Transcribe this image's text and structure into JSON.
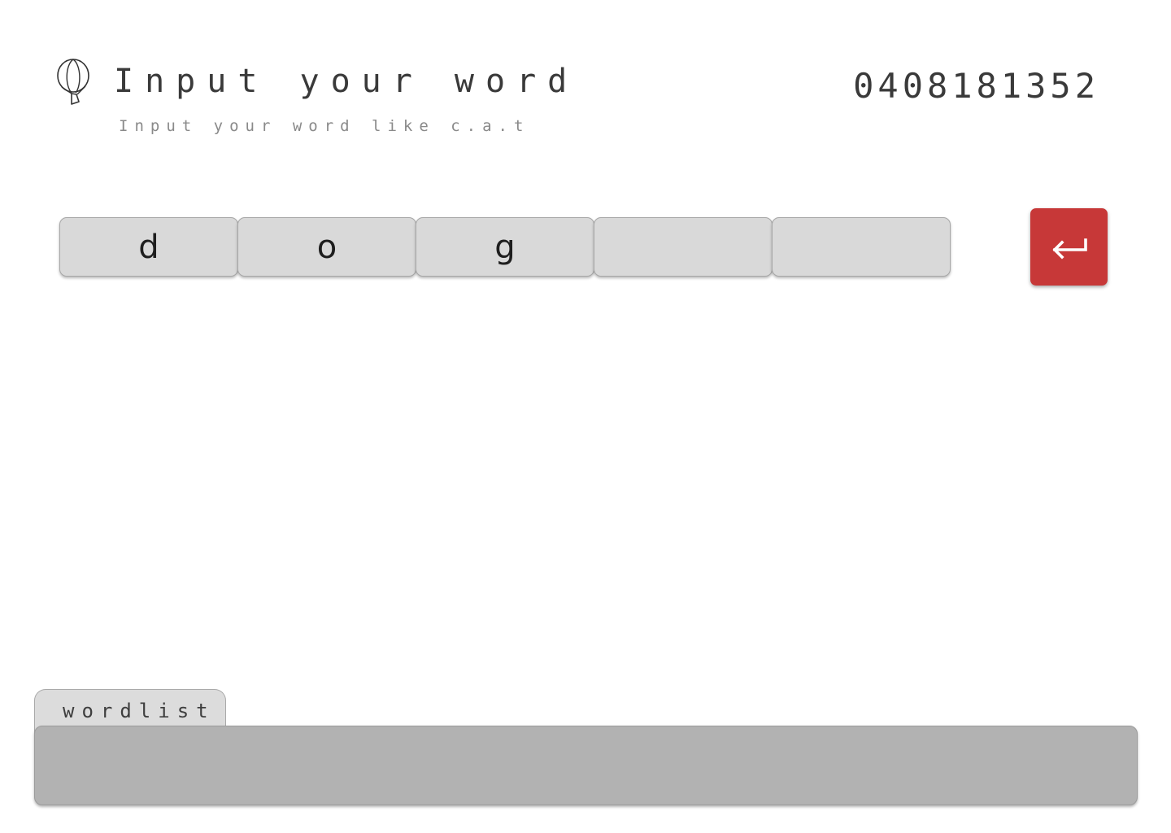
{
  "header": {
    "title": "Input your word",
    "subtitle": "Input your word like c.a.t",
    "code": "0408181352",
    "logo_icon": "hot-air-balloon-icon"
  },
  "input": {
    "slots": [
      "d",
      "o",
      "g",
      "",
      ""
    ],
    "enter_icon": "enter-arrow-icon"
  },
  "wordlist": {
    "tab_label": "wordlist",
    "items": []
  },
  "colors": {
    "enter_button": "#c73838",
    "slot_background": "#d9d9d9",
    "panel_background": "#b2b2b2"
  }
}
